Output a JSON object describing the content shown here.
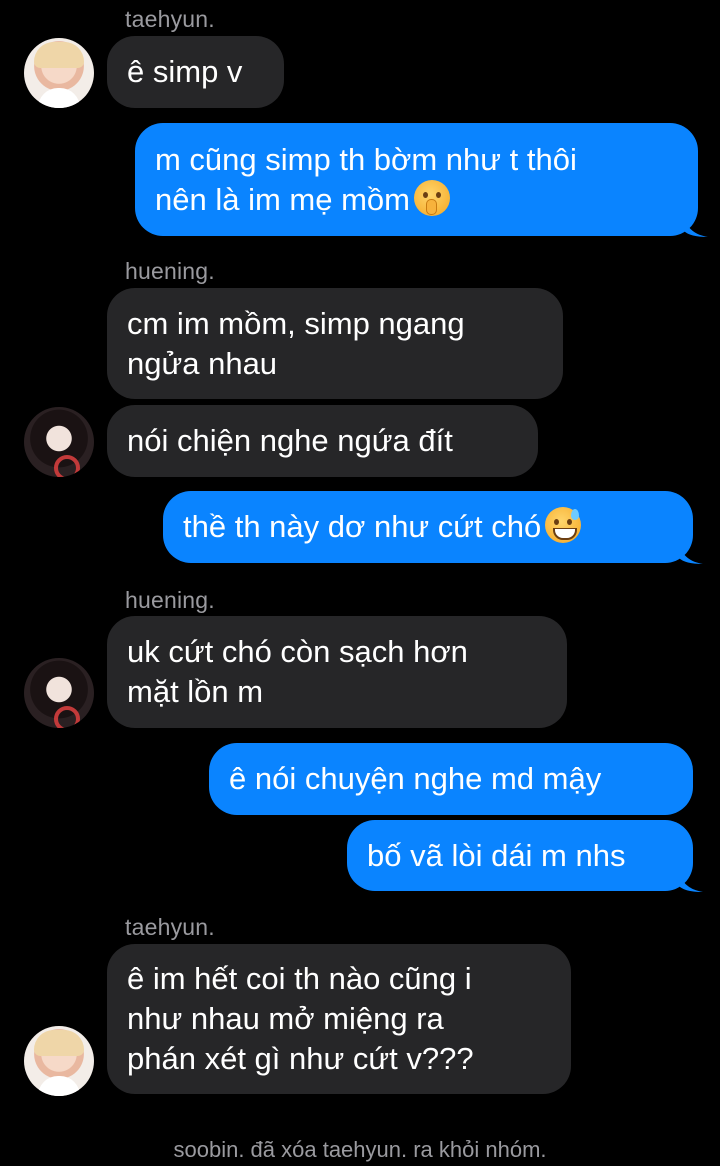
{
  "conversation": {
    "labels": {
      "taehyun": "taehyun.",
      "huening": "huening."
    },
    "messages": [
      {
        "text": "ê simp v"
      },
      {
        "line1": "m cũng simp th bờm như t thôi",
        "line2": "nên là im mẹ mồm",
        "emoji": "shushing-face-emoji"
      },
      {
        "line1": "cm im mồm, simp ngang",
        "line2": "ngửa nhau"
      },
      {
        "text": "nói chiện nghe ngứa đít"
      },
      {
        "text": "thề th này dơ như cứt chó",
        "emoji": "grinning-sweat-face-emoji"
      },
      {
        "line1": "uk cứt chó còn sạch hơn",
        "line2": "mặt lồn m"
      },
      {
        "text": "ê nói chuyện nghe md mậy"
      },
      {
        "text": "bố vã lòi dái m nhs"
      },
      {
        "line1": "ê im hết coi th nào cũng i",
        "line2": "như nhau mở miệng ra",
        "line3": "phán xét gì như cứt v???"
      }
    ],
    "system_notice": "soobin. đã xóa taehyun. ra khỏi nhóm."
  },
  "colors": {
    "background": "#000000",
    "incoming_bubble": "#262628",
    "outgoing_bubble": "#0a84ff",
    "sender_label": "#9a9a9f"
  }
}
